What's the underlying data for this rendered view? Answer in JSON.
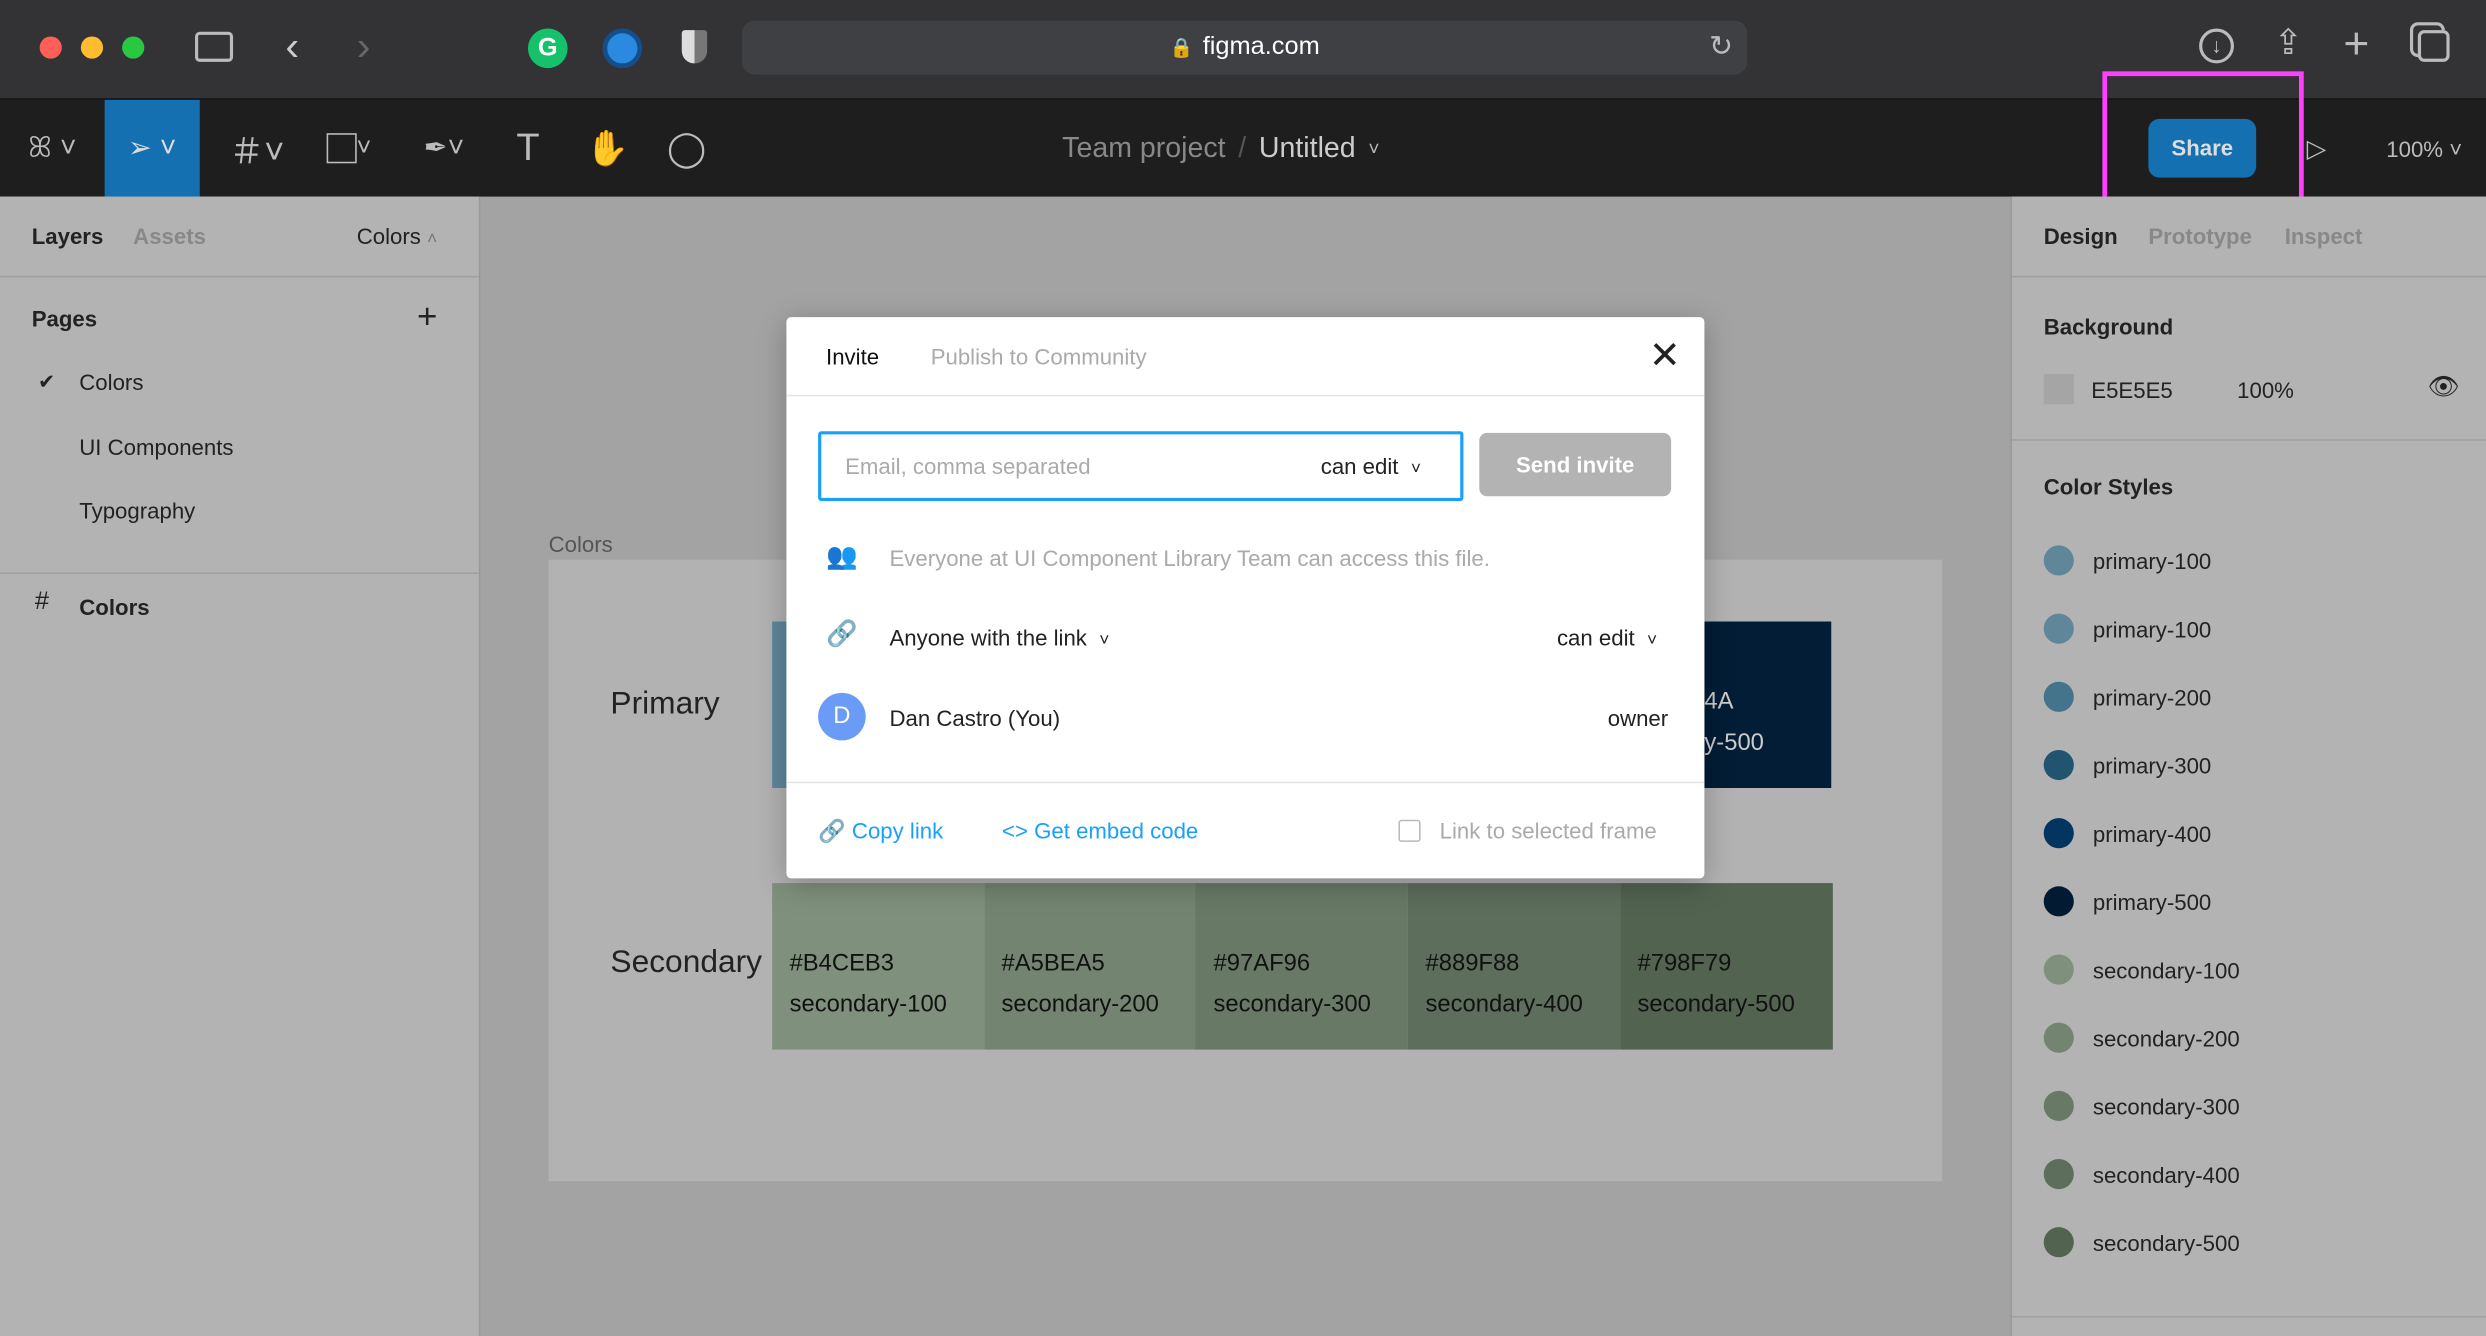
{
  "browser": {
    "url": "figma.com",
    "icons": [
      "sidebar-icon",
      "back-icon",
      "forward-icon",
      "grammarly-icon",
      "1password-icon",
      "privacy-shield-icon",
      "lock-icon",
      "reload-icon",
      "download-icon",
      "share-icon",
      "new-tab-icon",
      "tabs-icon"
    ]
  },
  "toolbar": {
    "project": "Team project",
    "separator": "/",
    "file": "Untitled",
    "share_label": "Share",
    "zoom": "100%",
    "accent": "#1470b0"
  },
  "left_panel": {
    "tabs": [
      "Layers",
      "Assets"
    ],
    "page_selector": "Colors",
    "pages_title": "Pages",
    "pages": [
      {
        "label": "Colors",
        "selected": true
      },
      {
        "label": "UI Components"
      },
      {
        "label": "Typography"
      }
    ],
    "layers": [
      {
        "label": "Colors"
      }
    ]
  },
  "canvas": {
    "frame_label": "Colors",
    "rows": [
      {
        "label": "Primary",
        "swatches": [
          {
            "hex": "",
            "name": "",
            "color": "#5e8799"
          },
          {
            "hex": "4A",
            "name": "y-500",
            "color": "#021d35"
          }
        ]
      },
      {
        "label": "Secondary",
        "swatches": [
          {
            "hex": "#B4CEB3",
            "name": "secondary-100",
            "color": "#7f917c"
          },
          {
            "hex": "#A5BEA5",
            "name": "secondary-200",
            "color": "#738571"
          },
          {
            "hex": "#97AF96",
            "name": "secondary-300",
            "color": "#687a66"
          },
          {
            "hex": "#889F88",
            "name": "secondary-400",
            "color": "#5d6e5c"
          },
          {
            "hex": "#798F79",
            "name": "secondary-500",
            "color": "#526350"
          }
        ]
      }
    ]
  },
  "modal": {
    "tabs": [
      "Invite",
      "Publish to Community"
    ],
    "email_placeholder": "Email, comma separated",
    "permission": "can edit",
    "send_label": "Send invite",
    "team_note": "Everyone at UI Component Library Team can access this file.",
    "link_access": "Anyone with the link",
    "link_permission": "can edit",
    "user": {
      "initial": "D",
      "name": "Dan Castro (You)",
      "role": "owner",
      "avatar_color": "#699bf7"
    },
    "copy_link": "Copy link",
    "embed": "Get embed code",
    "link_frame": "Link to selected frame",
    "link_frame_checked": false
  },
  "right_panel": {
    "tabs": [
      "Design",
      "Prototype",
      "Inspect"
    ],
    "background_title": "Background",
    "background_hex": "E5E5E5",
    "background_opacity": "100%",
    "styles_title": "Color Styles",
    "styles": [
      {
        "name": "primary-100",
        "color": "#5f8799"
      },
      {
        "name": "primary-100",
        "color": "#5f8799"
      },
      {
        "name": "primary-200",
        "color": "#43748c"
      },
      {
        "name": "primary-300",
        "color": "#21546f"
      },
      {
        "name": "primary-400",
        "color": "#033560"
      },
      {
        "name": "primary-500",
        "color": "#021b33"
      },
      {
        "name": "secondary-100",
        "color": "#7f917c"
      },
      {
        "name": "secondary-200",
        "color": "#738571"
      },
      {
        "name": "secondary-300",
        "color": "#687a66"
      },
      {
        "name": "secondary-400",
        "color": "#5d6e5c"
      },
      {
        "name": "secondary-500",
        "color": "#526350"
      }
    ]
  }
}
